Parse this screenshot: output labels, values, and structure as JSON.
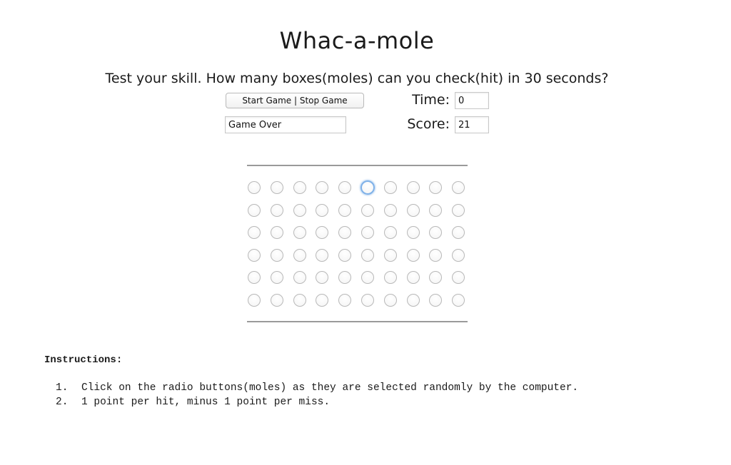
{
  "page": {
    "title": "Whac-a-mole",
    "subtitle": "Test your skill. How many boxes(moles) can you check(hit) in 30 seconds?"
  },
  "controls": {
    "start_stop_label": "Start Game | Stop Game",
    "status_value": "Game Over",
    "time_label": "Time:",
    "time_value": "0",
    "score_label": "Score:",
    "score_value": "21"
  },
  "board": {
    "rows": 6,
    "columns": 10,
    "focused_mole": {
      "row": 1,
      "column": 6
    }
  },
  "instructions": {
    "heading": "Instructions:",
    "items": [
      {
        "number": "1.",
        "text": "Click on the radio buttons(moles) as they are selected randomly by the computer."
      },
      {
        "number": "2.",
        "text": "1 point per hit, minus 1 point per miss."
      }
    ]
  },
  "colors": {
    "focus_ring": "#7fb1e8",
    "rule": "#9a9a9a"
  }
}
